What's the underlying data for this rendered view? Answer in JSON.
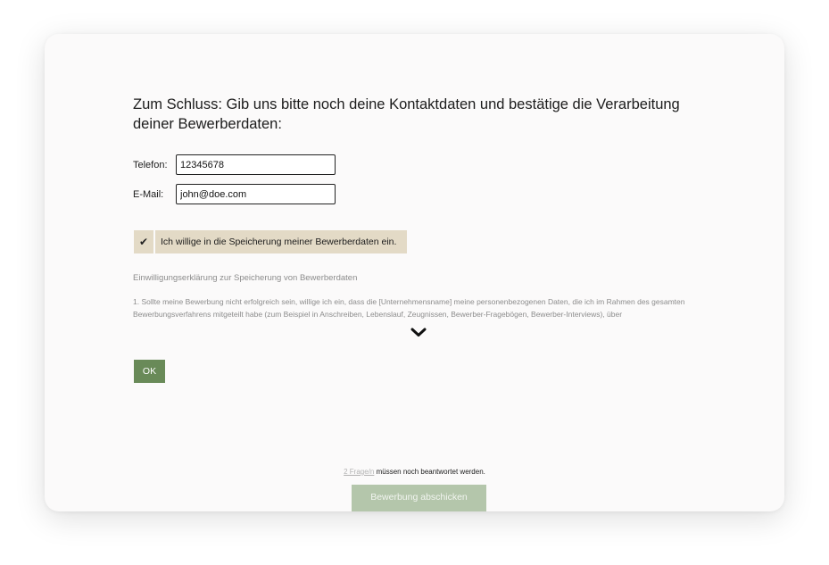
{
  "question": {
    "text": "Zum Schluss: Gib uns bitte noch deine Kontaktdaten und bestätige die Verarbeitung deiner Bewerberdaten:"
  },
  "form": {
    "phone_label": "Telefon:",
    "phone_value": "12345678",
    "email_label": "E-Mail:",
    "email_value": "john@doe.com"
  },
  "consent": {
    "checked": true,
    "check_glyph": "✔",
    "label": "Ich willige in die Speicherung meiner Bewerberdaten ein."
  },
  "declaration": {
    "title": "Einwilligungserklärung zur Speicherung von Bewerberdaten",
    "text": "1. Sollte meine Bewerbung nicht erfolgreich sein, willige ich ein, dass die [Unternehmensname] meine personenbezogenen Daten, die ich im Rahmen des gesamten Bewerbungsverfahrens mitgeteilt habe (zum Beispiel in Anschreiben, Lebenslauf, Zeugnissen, Bewerber-Fragebögen, Bewerber-Interviews), über"
  },
  "buttons": {
    "ok": "OK",
    "submit": "Bewerbung abschicken"
  },
  "footer": {
    "pending_link": "2 Frage/n",
    "pending_text": " müssen noch beantwortet werden."
  },
  "colors": {
    "accent_green": "#698a58",
    "submit_disabled": "#b4c6ab",
    "consent_background": "#e3dac6"
  },
  "icons": {
    "consent": "check-icon",
    "expand": "chevron-down-icon"
  }
}
